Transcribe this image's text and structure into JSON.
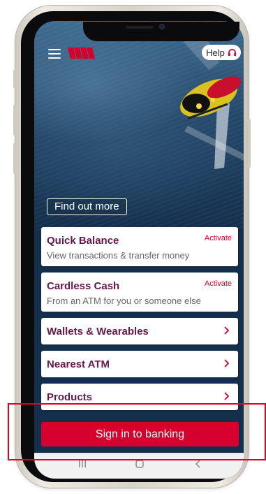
{
  "header": {
    "menu_icon": "hamburger-icon",
    "logo": "westpac-w-logo",
    "help_label": "Help",
    "help_icon": "headset-icon"
  },
  "hero": {
    "find_more_label": "Find out more"
  },
  "cards": {
    "quick_balance": {
      "title": "Quick Balance",
      "subtitle": "View transactions & transfer money",
      "action": "Activate"
    },
    "cardless_cash": {
      "title": "Cardless Cash",
      "subtitle": "From an ATM for you or someone else",
      "action": "Activate"
    },
    "wallets": {
      "title": "Wallets & Wearables"
    },
    "nearest_atm": {
      "title": "Nearest ATM"
    },
    "products": {
      "title": "Products"
    }
  },
  "signin": {
    "label": "Sign in to banking"
  },
  "navbar": {
    "icons": [
      "recent-apps-icon",
      "home-icon",
      "back-icon"
    ]
  },
  "colors": {
    "brand_red": "#d5002b",
    "title_purple": "#621a4b",
    "screen_bg": "#132f4c"
  }
}
